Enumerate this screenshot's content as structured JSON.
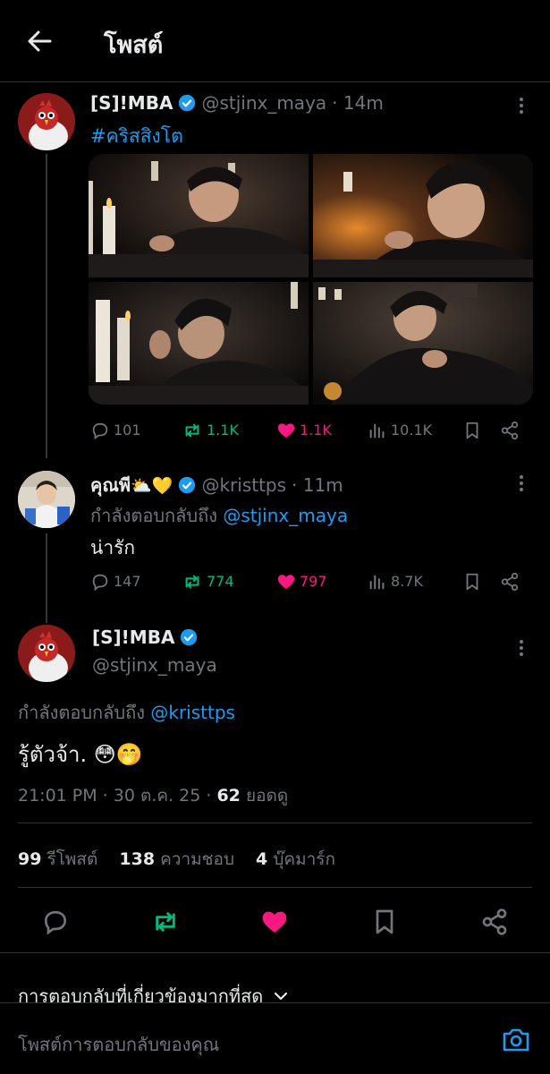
{
  "header": {
    "title": "โพสต์",
    "back_icon": "arrow-left-icon"
  },
  "post1": {
    "name": "[S]!MBA",
    "handle": "@stjinx_maya",
    "time": "· 14m",
    "hashtag": "#คริสสิงโต",
    "stats": {
      "replies": "101",
      "reposts": "1.1K",
      "likes": "1.1K",
      "views": "10.1K"
    }
  },
  "post2": {
    "name": "คุณพี",
    "name_emoji": "⛅💛",
    "handle": "@kristtps",
    "time": "· 11m",
    "replying_prefix": "กำลังตอบกลับถึง",
    "replying_to": "@stjinx_maya",
    "text": "น่ารัก",
    "stats": {
      "replies": "147",
      "reposts": "774",
      "likes": "797",
      "views": "8.7K"
    }
  },
  "main_post": {
    "name": "[S]!MBA",
    "handle": "@stjinx_maya",
    "replying_prefix": "กำลังตอบกลับถึง",
    "replying_to": "@kristtps",
    "text": "รู้ตัวจ้า. 😳🤭",
    "datetime": "21:01 PM · 30 ต.ค. 25 ·",
    "views_count": "62",
    "views_label": "ยอดดู",
    "reposts_count": "99",
    "reposts_label": "รีโพสต์",
    "likes_count": "138",
    "likes_label": "ความชอบ",
    "bookmarks_count": "4",
    "bookmarks_label": "บุ๊คมาร์ก"
  },
  "sort_label": "การตอบกลับที่เกี่ยวข้องมากที่สุด",
  "reply_bar": {
    "placeholder": "โพสต์การตอบกลับของคุณ"
  },
  "colors": {
    "background": "#000000",
    "text": "#e7e9ea",
    "muted": "#71767b",
    "link": "#1d9bf0",
    "repost_green": "#00ba7c",
    "like_pink": "#f91880",
    "divider": "#2f3336"
  }
}
